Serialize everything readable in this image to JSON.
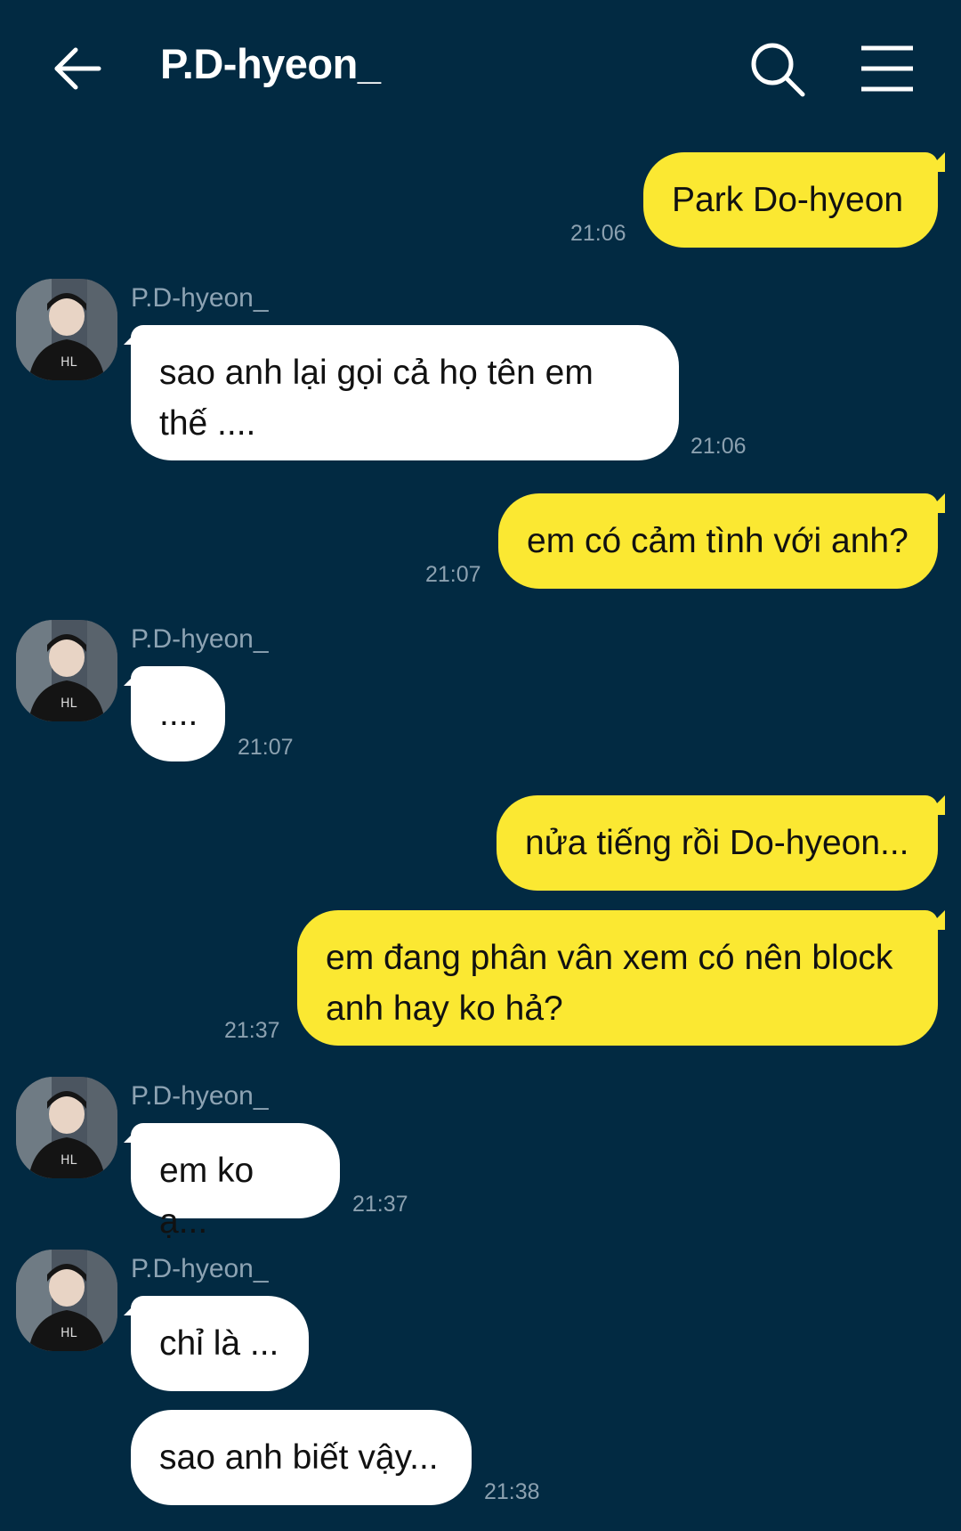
{
  "header": {
    "title": "P.D-hyeon_",
    "back_icon": "arrow-left-icon",
    "search_icon": "search-icon",
    "menu_icon": "hamburger-menu-icon"
  },
  "colors": {
    "background": "#022a42",
    "outgoing_bubble": "#fbe832",
    "incoming_bubble": "#ffffff",
    "timestamp": "#8ca1b0"
  },
  "messages": [
    {
      "direction": "out",
      "text": "Park Do-hyeon",
      "time": "21:06"
    },
    {
      "direction": "in",
      "sender": "P.D-hyeon_",
      "text_lines": [
        "sao anh lại gọi cả họ tên em",
        "thế ...."
      ],
      "time": "21:06"
    },
    {
      "direction": "out",
      "text": "em có cảm tình với anh?",
      "time": "21:07"
    },
    {
      "direction": "in",
      "sender": "P.D-hyeon_",
      "text": "....",
      "time": "21:07"
    },
    {
      "direction": "out",
      "text": "nửa tiếng rồi Do-hyeon..."
    },
    {
      "direction": "out",
      "text_lines": [
        "em đang phân vân xem có nên block",
        "anh hay ko hả?"
      ],
      "time": "21:37"
    },
    {
      "direction": "in",
      "sender": "P.D-hyeon_",
      "text": "em ko ạ...",
      "time": "21:37"
    },
    {
      "direction": "in",
      "sender": "P.D-hyeon_",
      "text": "chỉ là ..."
    },
    {
      "direction": "in",
      "text": "sao anh biết vậy...",
      "time": "21:38"
    }
  ]
}
